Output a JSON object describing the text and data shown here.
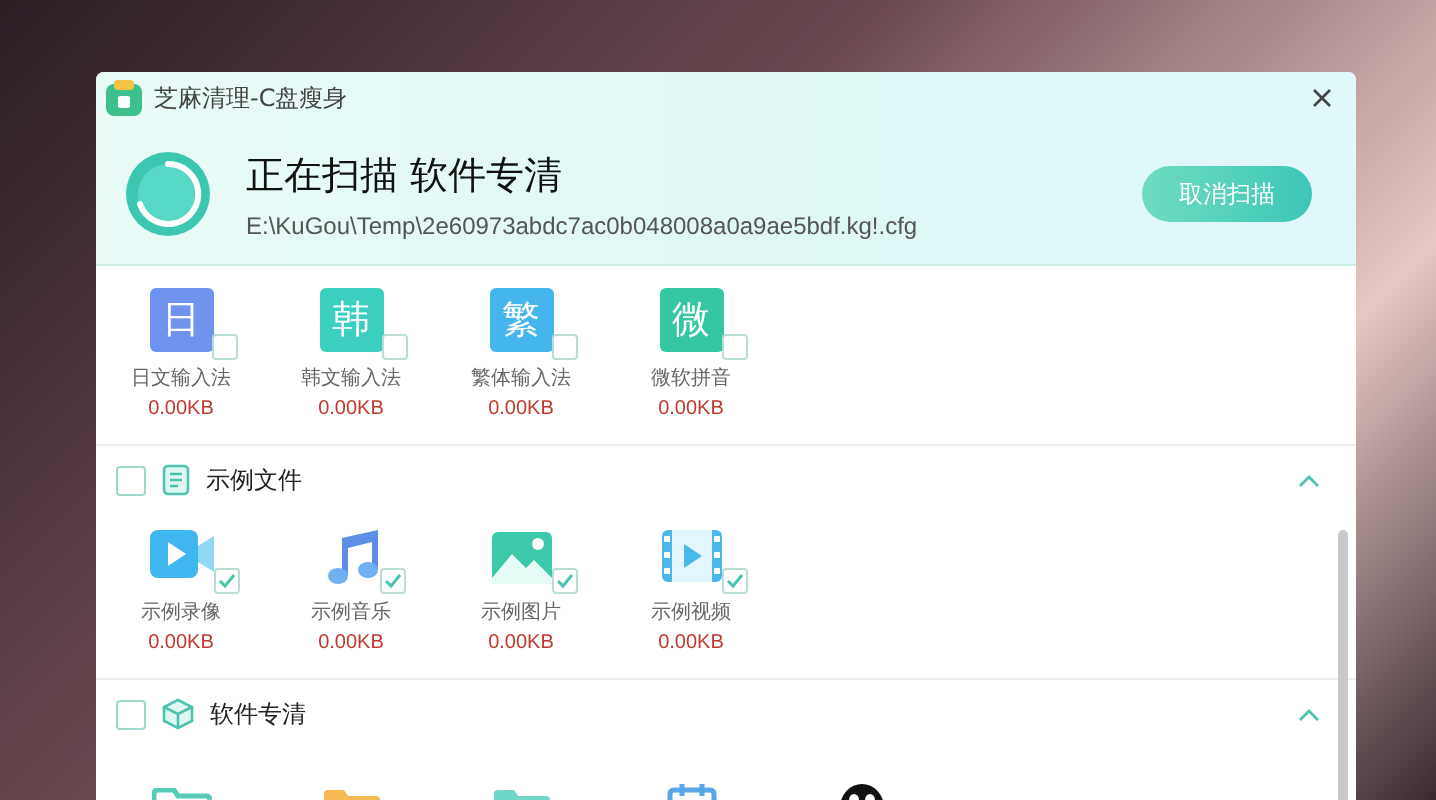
{
  "window": {
    "title": "芝麻清理-C盘瘦身"
  },
  "scan": {
    "heading": "正在扫描 软件专清",
    "path": "E:\\KuGou\\Temp\\2e60973abdc7ac0b048008a0a9ae5bdf.kg!.cfg",
    "cancel_button": "取消扫描"
  },
  "groups": [
    {
      "items": [
        {
          "kind": "glyph",
          "glyph": "日",
          "color": "#6f93ef",
          "label": "日文输入法",
          "size": "0.00KB",
          "checked": false
        },
        {
          "kind": "glyph",
          "glyph": "韩",
          "color": "#3ccfc0",
          "label": "韩文输入法",
          "size": "0.00KB",
          "checked": false
        },
        {
          "kind": "glyph",
          "glyph": "繁",
          "color": "#45b6ec",
          "label": "繁体输入法",
          "size": "0.00KB",
          "checked": false
        },
        {
          "kind": "glyph",
          "glyph": "微",
          "color": "#35c7a2",
          "label": "微软拼音",
          "size": "0.00KB",
          "checked": false
        }
      ]
    },
    {
      "title": "示例文件",
      "checked": false,
      "expanded": true,
      "items": [
        {
          "kind": "video",
          "label": "示例录像",
          "size": "0.00KB",
          "checked": true
        },
        {
          "kind": "music",
          "label": "示例音乐",
          "size": "0.00KB",
          "checked": true
        },
        {
          "kind": "image",
          "label": "示例图片",
          "size": "0.00KB",
          "checked": true
        },
        {
          "kind": "film",
          "label": "示例视频",
          "size": "0.00KB",
          "checked": true
        }
      ]
    },
    {
      "title": "软件专清",
      "checked": false,
      "expanded": true,
      "items": [
        {
          "kind": "folder-teal"
        },
        {
          "kind": "folder-orange"
        },
        {
          "kind": "folder-screen"
        },
        {
          "kind": "calendar"
        },
        {
          "kind": "penguin"
        }
      ]
    }
  ]
}
